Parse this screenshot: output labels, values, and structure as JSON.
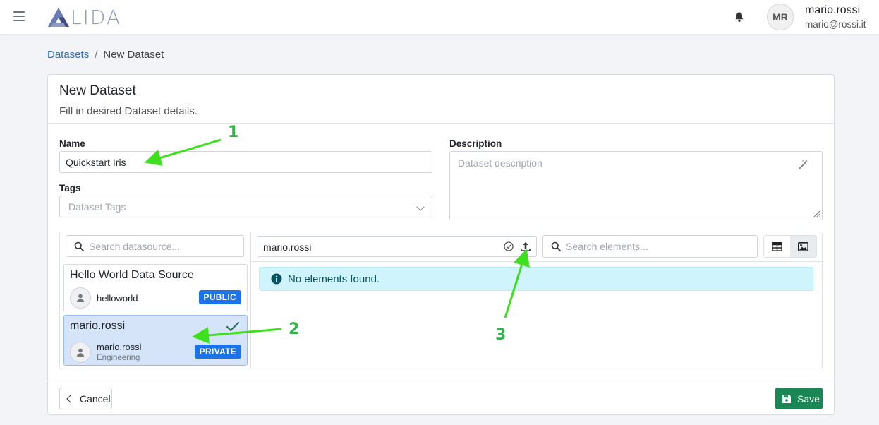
{
  "topbar": {
    "logo_text": "LIDA",
    "avatar_initials": "MR",
    "user_name": "mario.rossi",
    "user_email": "mario@rossi.it"
  },
  "breadcrumb": {
    "parent": "Datasets",
    "separator": "/",
    "current": "New Dataset"
  },
  "form": {
    "title": "New Dataset",
    "subtitle": "Fill in desired Dataset details.",
    "name_label": "Name",
    "name_value": "Quickstart Iris",
    "tags_label": "Tags",
    "tags_placeholder": "Dataset Tags",
    "description_label": "Description",
    "description_placeholder": "Dataset description"
  },
  "datasource_panel": {
    "search_placeholder": "Search datasource...",
    "items": [
      {
        "title": "Hello World Data Source",
        "owner": "helloworld",
        "org": "",
        "badge": "PUBLIC",
        "selected": false
      },
      {
        "title": "mario.rossi",
        "owner": "mario.rossi",
        "org": "Engineering",
        "badge": "PRIVATE",
        "selected": true
      }
    ]
  },
  "elements_panel": {
    "source_value": "mario.rossi",
    "search_placeholder": "Search elements...",
    "empty_message": "No elements found."
  },
  "footer": {
    "cancel_label": "Cancel",
    "save_label": "Save"
  },
  "annotations": {
    "one": "1",
    "two": "2",
    "three": "3"
  },
  "colors": {
    "accent": "#1a73e8",
    "save": "#198754",
    "link": "#2a6fb8",
    "annotation": "#2fb54a",
    "alert_bg": "#cff4fc"
  }
}
